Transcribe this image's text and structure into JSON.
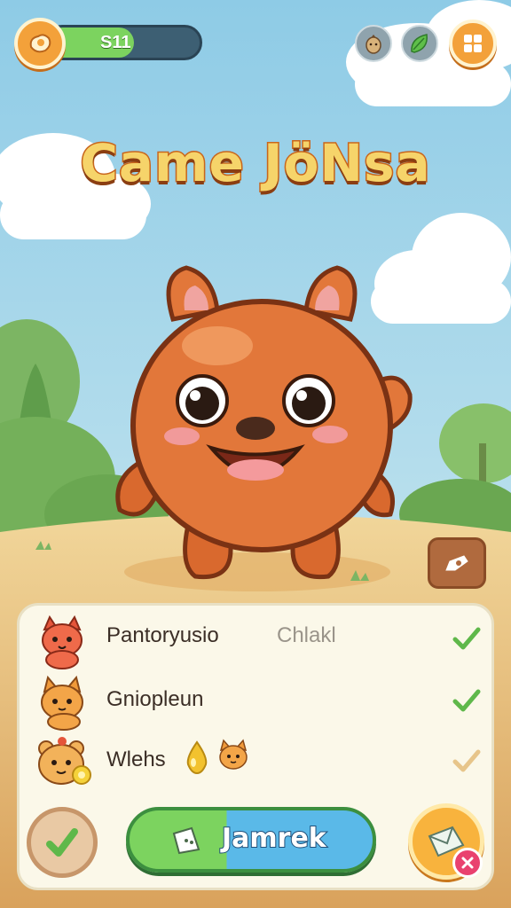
{
  "hud": {
    "coins": "S11",
    "coin_fill_fraction": 0.57,
    "coin_icon": "coin-icon",
    "menu_icon": "grid-menu-icon"
  },
  "title": "Came JöNsa",
  "list": [
    {
      "name": "Pantoryusio",
      "extra": "Chlakl",
      "icon": "orange-cat-icon",
      "status_icon": "check-icon"
    },
    {
      "name": "Gniopleun",
      "extra": "",
      "icon": "fox-icon",
      "status_icon": "check-icon"
    },
    {
      "name": "Wlehs",
      "extra": "",
      "icon": "bear-icon",
      "status_icon": "check-icon"
    }
  ],
  "actions": {
    "main_label": "Jamrek",
    "back_icon": "check-back-icon",
    "share_icon": "envelope-icon",
    "close_icon": "close-icon"
  },
  "colors": {
    "accent_orange": "#f3a13a",
    "green": "#7cd35f",
    "blue": "#5ab9e8",
    "creature": "#e2773a"
  }
}
